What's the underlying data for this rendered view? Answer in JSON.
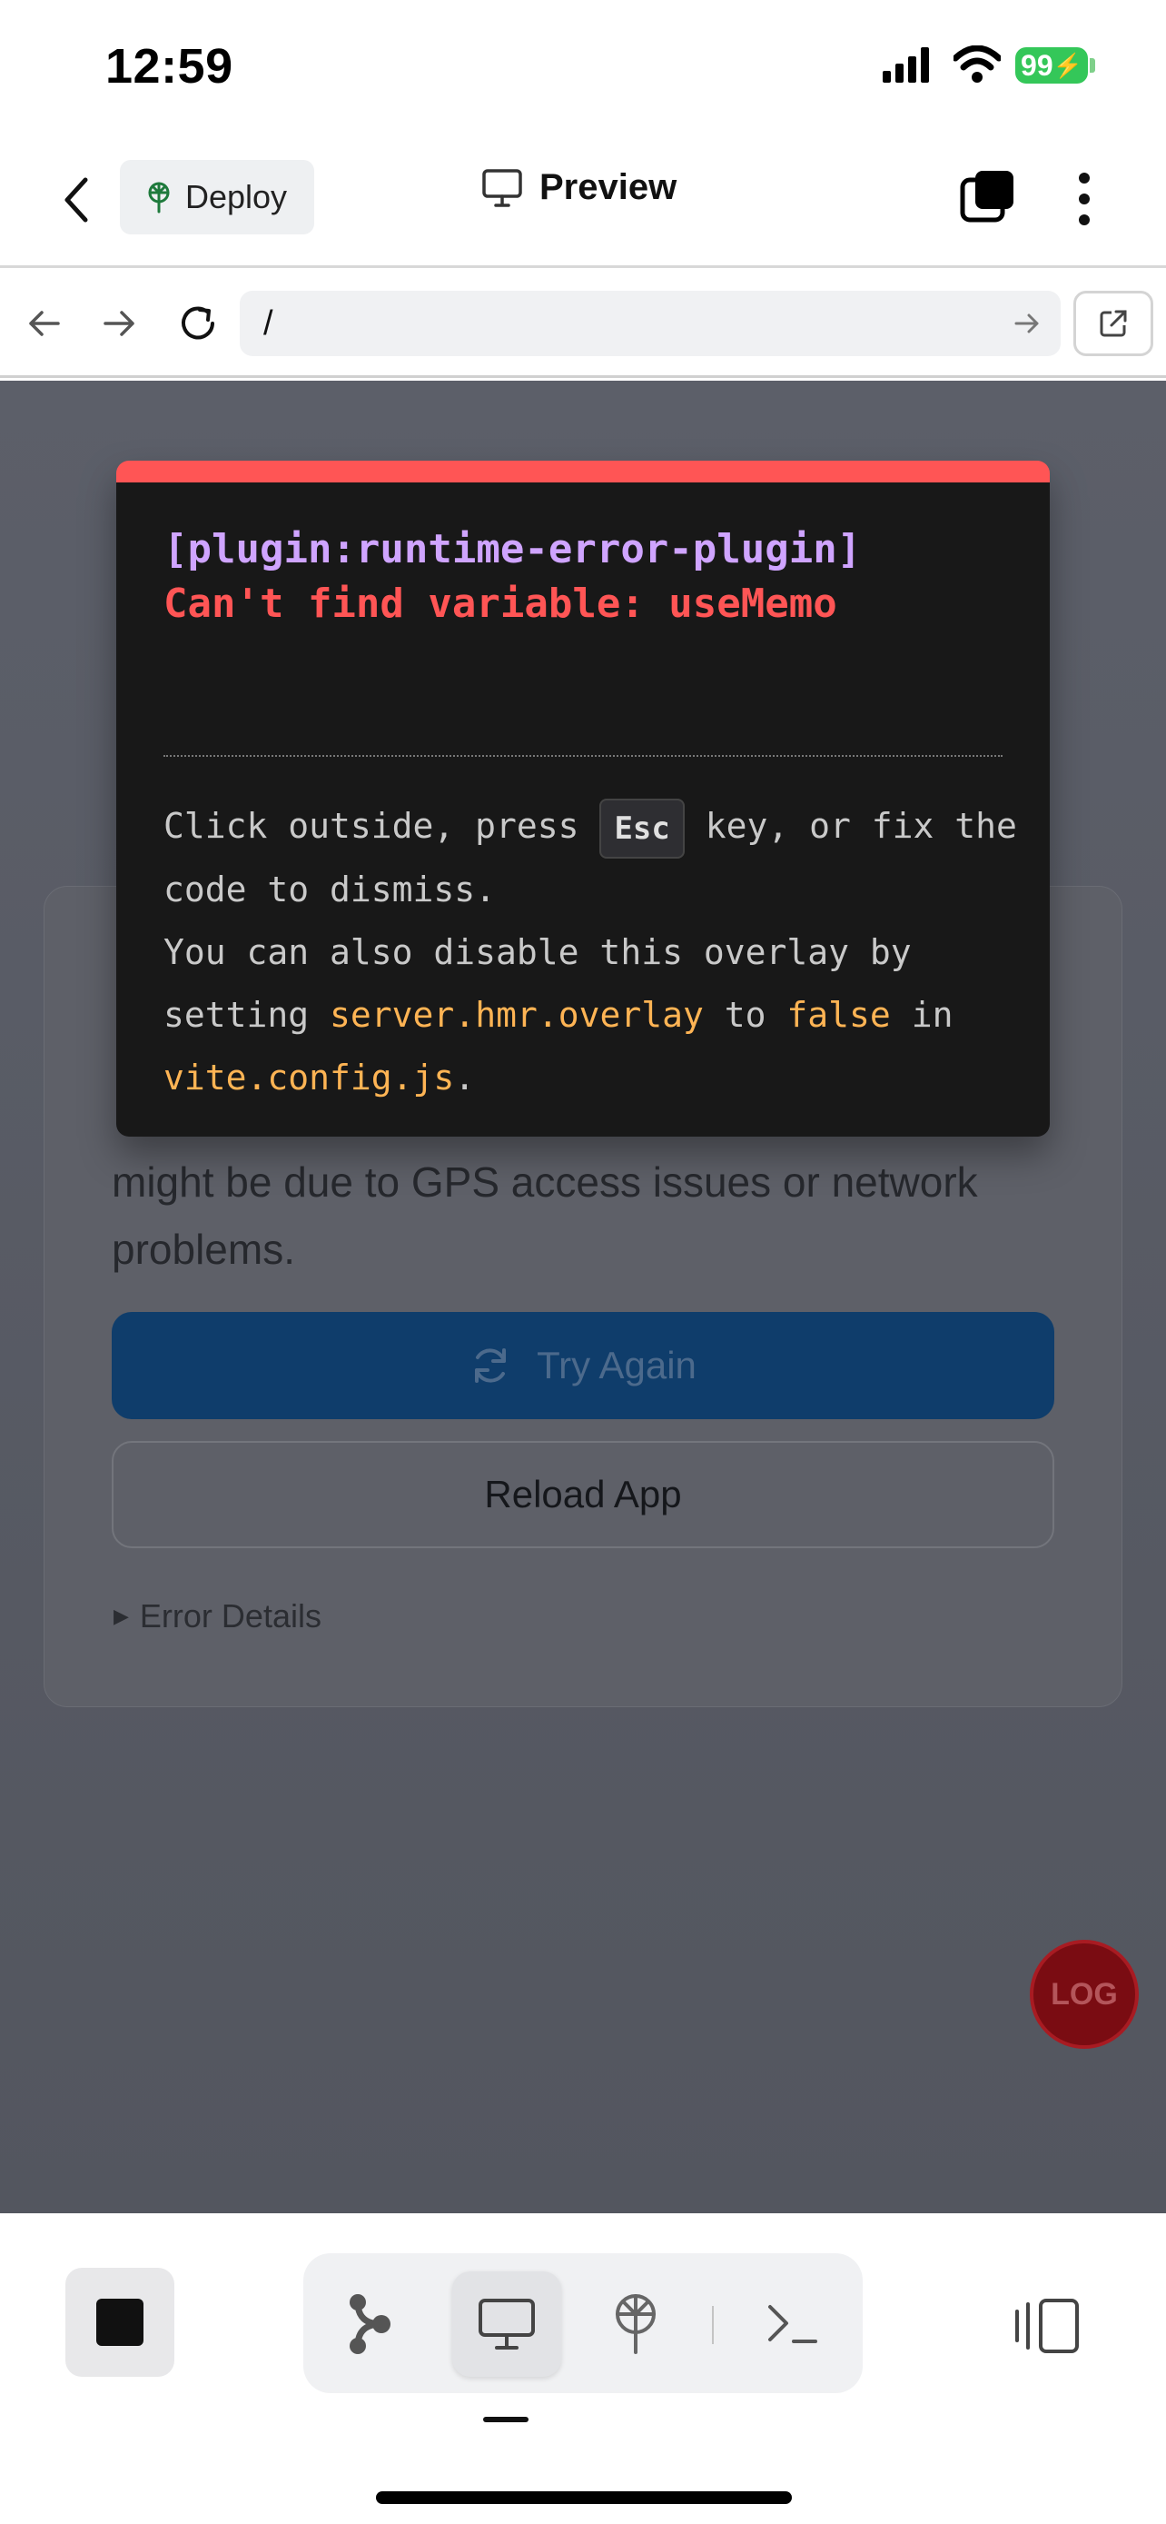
{
  "status_bar": {
    "time": "12:59",
    "battery": "99"
  },
  "header": {
    "deploy_label": "Deploy",
    "preview_label": "Preview"
  },
  "url_bar": {
    "path": "/"
  },
  "overlay": {
    "plugin": "[plugin:runtime-error-plugin]",
    "message": "Can't find variable: useMemo",
    "tip_1": "Click outside, press",
    "tip_key": "Esc",
    "tip_2": "key, or fix the code to dismiss.",
    "tip_3": "You can also disable this overlay by setting",
    "tip_code_1": "server.hmr.overlay",
    "tip_4": "to",
    "tip_code_2": "false",
    "tip_5": "in",
    "tip_code_3": "vite.config.js",
    "tip_6": "."
  },
  "app_card": {
    "message": "might be due to GPS access issues or network problems.",
    "try_again_label": "Try Again",
    "reload_label": "Reload App",
    "error_details_label": "Error Details"
  },
  "log_button": {
    "label": "LOG"
  },
  "colors": {
    "overlay_accent": "#ff5555",
    "battery": "#34c759",
    "primary_button": "#0f3d6b"
  },
  "icons": [
    "back-icon",
    "deploy-icon",
    "monitor-icon",
    "tabs-icon",
    "more-icon",
    "nav-back-icon",
    "nav-forward-icon",
    "reload-icon",
    "go-icon",
    "open-external-icon",
    "refresh-icon",
    "stop-icon",
    "branch-icon",
    "desktop-icon",
    "deploy-tool-icon",
    "terminal-icon",
    "split-view-icon"
  ]
}
